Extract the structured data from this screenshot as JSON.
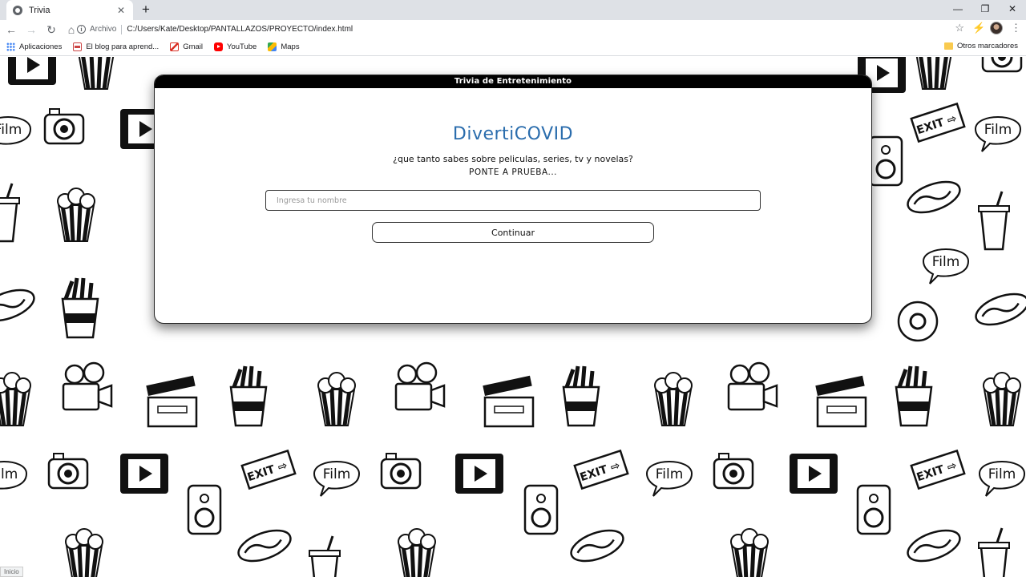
{
  "browser": {
    "tab_title": "Trivia",
    "scheme_label": "Archivo",
    "url": "C:/Users/Kate/Desktop/PANTALLAZOS/PROYECTO/index.html",
    "bookmarks": [
      {
        "label": "Aplicaciones",
        "icon": "apps-icon"
      },
      {
        "label": "El blog para aprend...",
        "icon": "blog-icon"
      },
      {
        "label": "Gmail",
        "icon": "gmail-icon"
      },
      {
        "label": "YouTube",
        "icon": "youtube-icon"
      },
      {
        "label": "Maps",
        "icon": "maps-icon"
      }
    ],
    "other_bookmarks": "Otros marcadores"
  },
  "card": {
    "header": "Trivia de Entretenimiento",
    "brand": "DivertiCOVID",
    "question": "¿que tanto sabes sobre peliculas, series, tv y novelas?",
    "tagline": "PONTE A PRUEBA...",
    "name_placeholder": "Ingresa tu nombre",
    "continue_label": "Continuar"
  },
  "status_text": "Inicio",
  "colors": {
    "brand": "#2b6dad",
    "header_bg": "#000000",
    "chrome_bg": "#dee1e6"
  }
}
